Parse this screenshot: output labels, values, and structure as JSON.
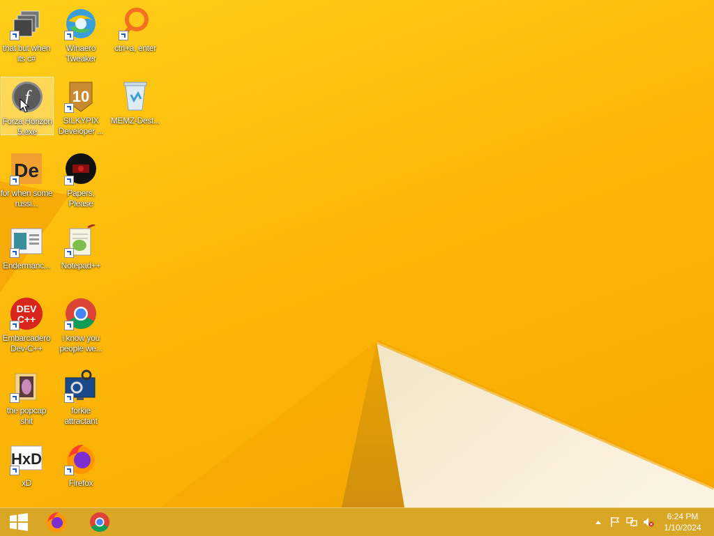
{
  "desktop": {
    "icons": [
      {
        "label": "that but when its c#",
        "icon": "stacked-windows-icon"
      },
      {
        "label": "Winaero Tweaker",
        "icon": "winaero-icon"
      },
      {
        "label": "ctrl+a, enter",
        "icon": "orange-ring-icon"
      },
      {
        "label": "Forza Horizon 5.exe",
        "icon": "flash-player-icon"
      },
      {
        "label": "SILKYPIX Developer ...",
        "icon": "silkypix-10-icon"
      },
      {
        "label": "MEMZ-Dest...",
        "icon": "recycle-bin-icon"
      },
      {
        "label": "for when some russi...",
        "icon": "de-icon"
      },
      {
        "label": "Papers, Please",
        "icon": "papers-please-icon"
      },
      {
        "label": "Endermanc...",
        "icon": "window-preview-icon"
      },
      {
        "label": "Notepad++",
        "icon": "notepad-plus-plus-icon"
      },
      {
        "label": "Embarcadero Dev-C++",
        "icon": "dev-cpp-icon"
      },
      {
        "label": "i know you people we...",
        "icon": "chrome-icon"
      },
      {
        "label": "the popcap shit",
        "icon": "folder-icon"
      },
      {
        "label": "forkie attractant",
        "icon": "monitor-gears-icon"
      },
      {
        "label": "xD",
        "icon": "hxd-icon"
      },
      {
        "label": "Firefox",
        "icon": "firefox-icon"
      }
    ]
  },
  "taskbar": {
    "start": "windows-logo-icon",
    "pinned": [
      "firefox-icon",
      "chrome-icon"
    ],
    "clock": {
      "time": "6:24 PM",
      "date": "1/10/2024"
    }
  },
  "colors": {
    "wallpaper": "#fcb80a",
    "taskbar": "#d6a628",
    "white_wedge": "#f5ecd8"
  }
}
